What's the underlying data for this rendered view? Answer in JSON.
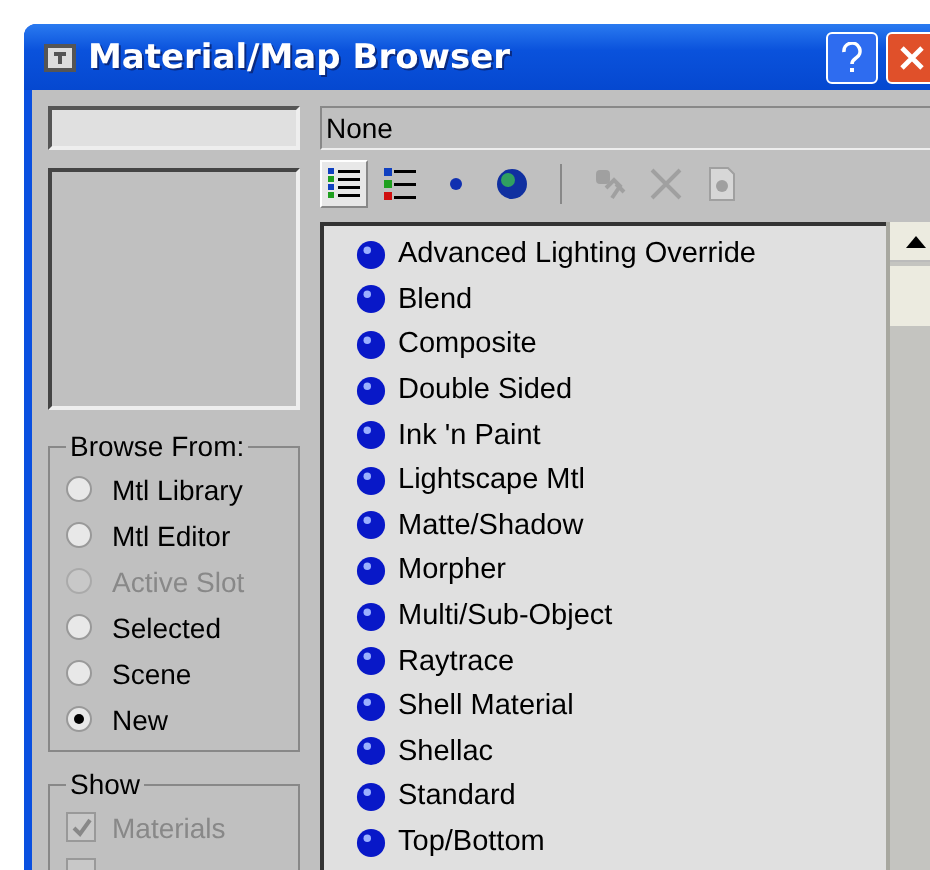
{
  "window": {
    "title": "Material/Map Browser"
  },
  "current_map": {
    "value": "None"
  },
  "view_buttons": [
    {
      "kind": "list",
      "selected": true
    },
    {
      "kind": "list-icons",
      "selected": false
    },
    {
      "kind": "small-icons",
      "selected": false
    },
    {
      "kind": "large-icons",
      "selected": false
    }
  ],
  "action_buttons": [
    {
      "kind": "update",
      "disabled": true
    },
    {
      "kind": "delete",
      "disabled": true
    },
    {
      "kind": "clear",
      "disabled": true
    }
  ],
  "browse_from": {
    "title": "Browse From:",
    "options": [
      {
        "label": "Mtl Library",
        "selected": false,
        "disabled": false
      },
      {
        "label": "Mtl Editor",
        "selected": false,
        "disabled": false
      },
      {
        "label": "Active Slot",
        "selected": false,
        "disabled": true
      },
      {
        "label": "Selected",
        "selected": false,
        "disabled": false
      },
      {
        "label": "Scene",
        "selected": false,
        "disabled": false
      },
      {
        "label": "New",
        "selected": true,
        "disabled": false
      }
    ]
  },
  "show": {
    "title": "Show",
    "options": [
      {
        "label": "Materials",
        "checked": true,
        "disabled": true
      },
      {
        "checked": false,
        "disabled": true
      }
    ]
  },
  "materials": [
    {
      "name": "Advanced Lighting Override"
    },
    {
      "name": "Blend"
    },
    {
      "name": "Composite"
    },
    {
      "name": "Double Sided"
    },
    {
      "name": "Ink 'n Paint"
    },
    {
      "name": "Lightscape Mtl"
    },
    {
      "name": "Matte/Shadow"
    },
    {
      "name": "Morpher"
    },
    {
      "name": "Multi/Sub-Object"
    },
    {
      "name": "Raytrace"
    },
    {
      "name": "Shell Material"
    },
    {
      "name": "Shellac"
    },
    {
      "name": "Standard"
    },
    {
      "name": "Top/Bottom"
    }
  ]
}
